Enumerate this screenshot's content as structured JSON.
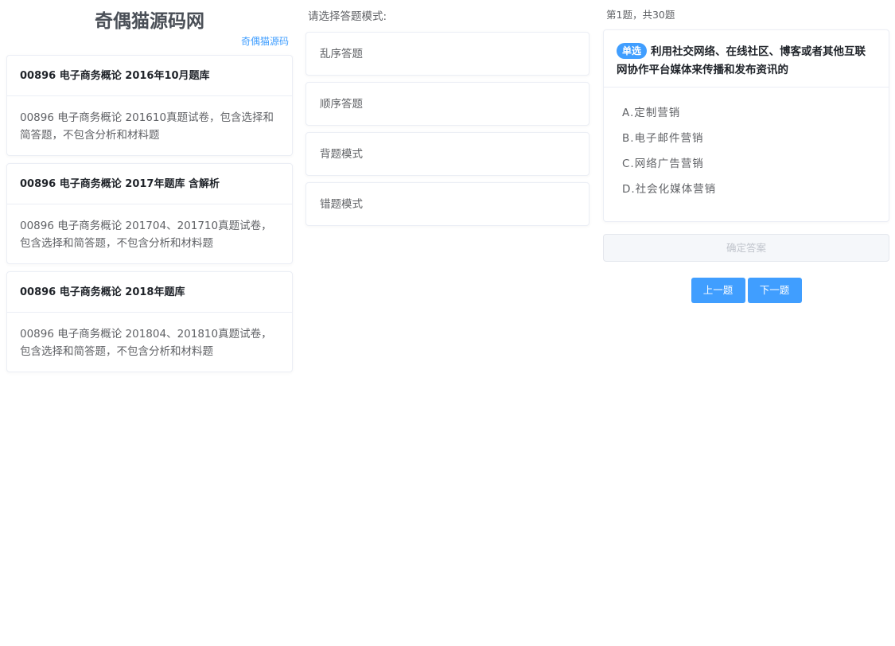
{
  "site": {
    "title": "奇偶猫源码网",
    "link": "奇偶猫源码"
  },
  "banks": [
    {
      "title": "00896 电子商务概论 2016年10月题库",
      "desc": "00896 电子商务概论 201610真题试卷，包含选择和简答题，不包含分析和材料题"
    },
    {
      "title": "00896 电子商务概论 2017年题库 含解析",
      "desc": "00896 电子商务概论 201704、201710真题试卷，包含选择和简答题，不包含分析和材料题"
    },
    {
      "title": "00896 电子商务概论 2018年题库",
      "desc": "00896 电子商务概论 201804、201810真题试卷，包含选择和简答题，不包含分析和材料题"
    }
  ],
  "modes": {
    "title": "请选择答题模式:",
    "items": [
      "乱序答题",
      "顺序答题",
      "背题模式",
      "错题模式"
    ]
  },
  "question": {
    "progress": "第1题，共30题",
    "type_tag": "单选",
    "text": "利用社交网络、在线社区、博客或者其他互联网协作平台媒体来传播和发布资讯的",
    "options": [
      "A.定制营销",
      "B.电子邮件营销",
      "C.网络广告营销",
      "D.社会化媒体营销"
    ],
    "confirm_label": "确定答案",
    "prev_label": "上一题",
    "next_label": "下一题"
  },
  "colors": {
    "primary": "#409eff",
    "border": "#ebeef5",
    "text_secondary": "#606266"
  }
}
